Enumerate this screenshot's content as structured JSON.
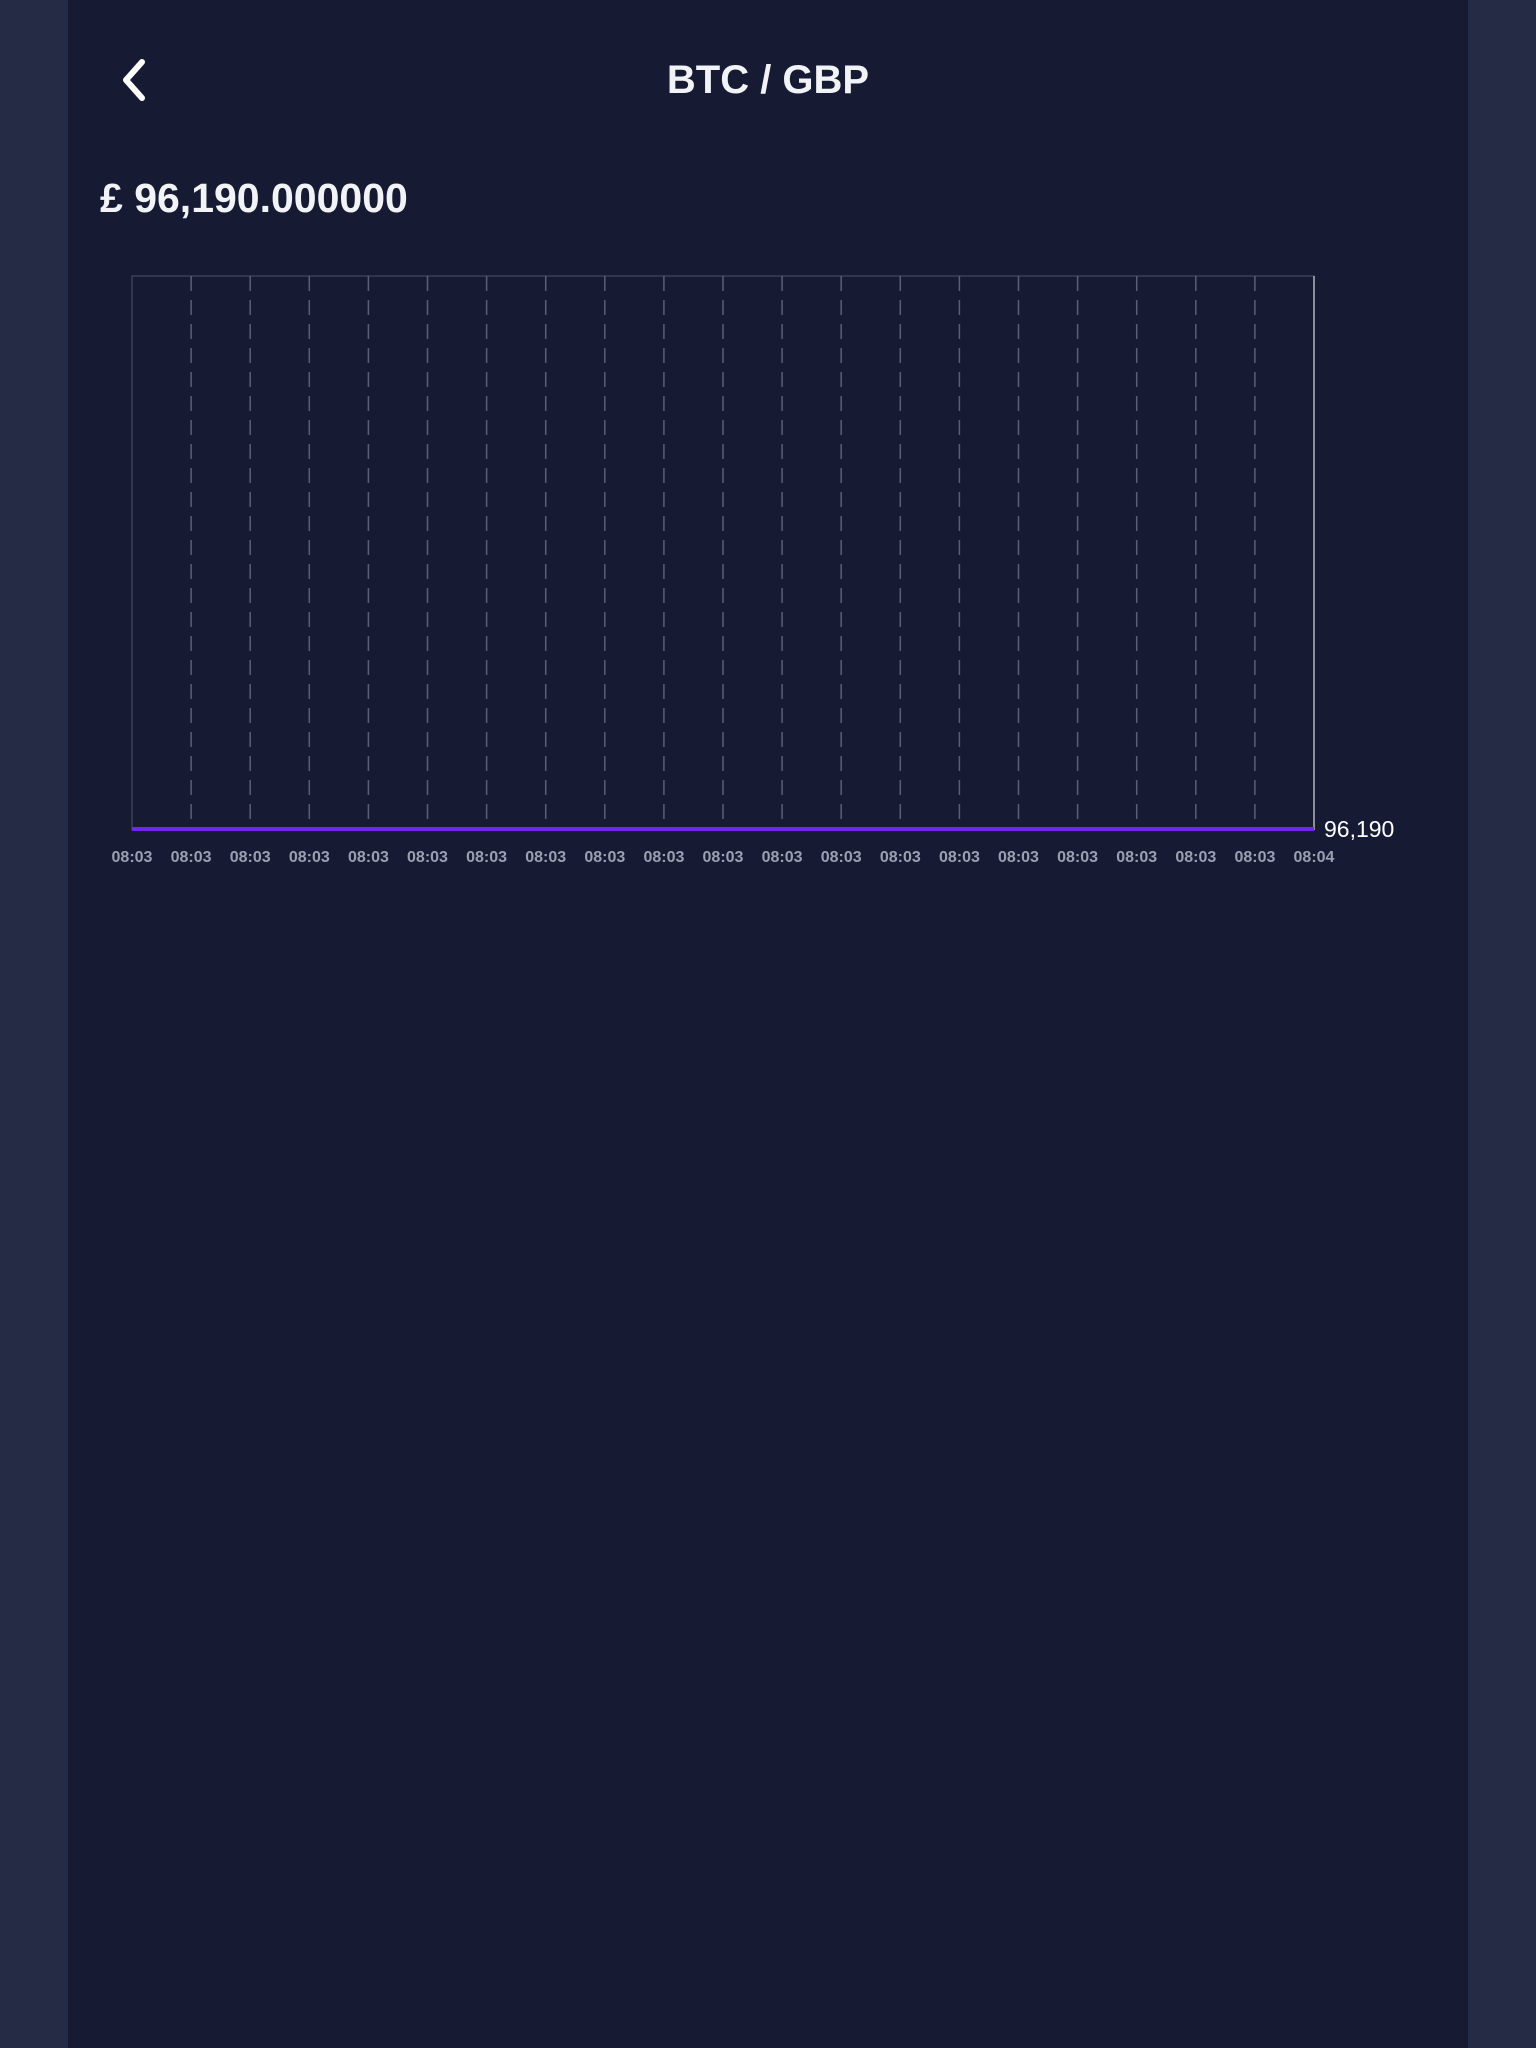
{
  "header": {
    "title": "BTC / GBP",
    "back_icon": "chevron-left-icon"
  },
  "price": {
    "display": "£ 96,190.000000"
  },
  "colors": {
    "background": "#161b33",
    "gutter": "#262b45",
    "line": "#6d28f0",
    "grid": "#5a6073"
  },
  "chart_data": {
    "type": "line",
    "x": [
      "08:03",
      "08:03",
      "08:03",
      "08:03",
      "08:03",
      "08:03",
      "08:03",
      "08:03",
      "08:03",
      "08:03",
      "08:03",
      "08:03",
      "08:03",
      "08:03",
      "08:03",
      "08:03",
      "08:03",
      "08:03",
      "08:03",
      "08:03",
      "08:04"
    ],
    "series": [
      {
        "values": [
          96190,
          96190,
          96190,
          96190,
          96190,
          96190,
          96190,
          96190,
          96190,
          96190,
          96190,
          96190,
          96190,
          96190,
          96190,
          96190,
          96190,
          96190,
          96190,
          96190,
          96190
        ]
      }
    ],
    "y_tick_labels": [
      "96,190"
    ],
    "grid": true
  }
}
